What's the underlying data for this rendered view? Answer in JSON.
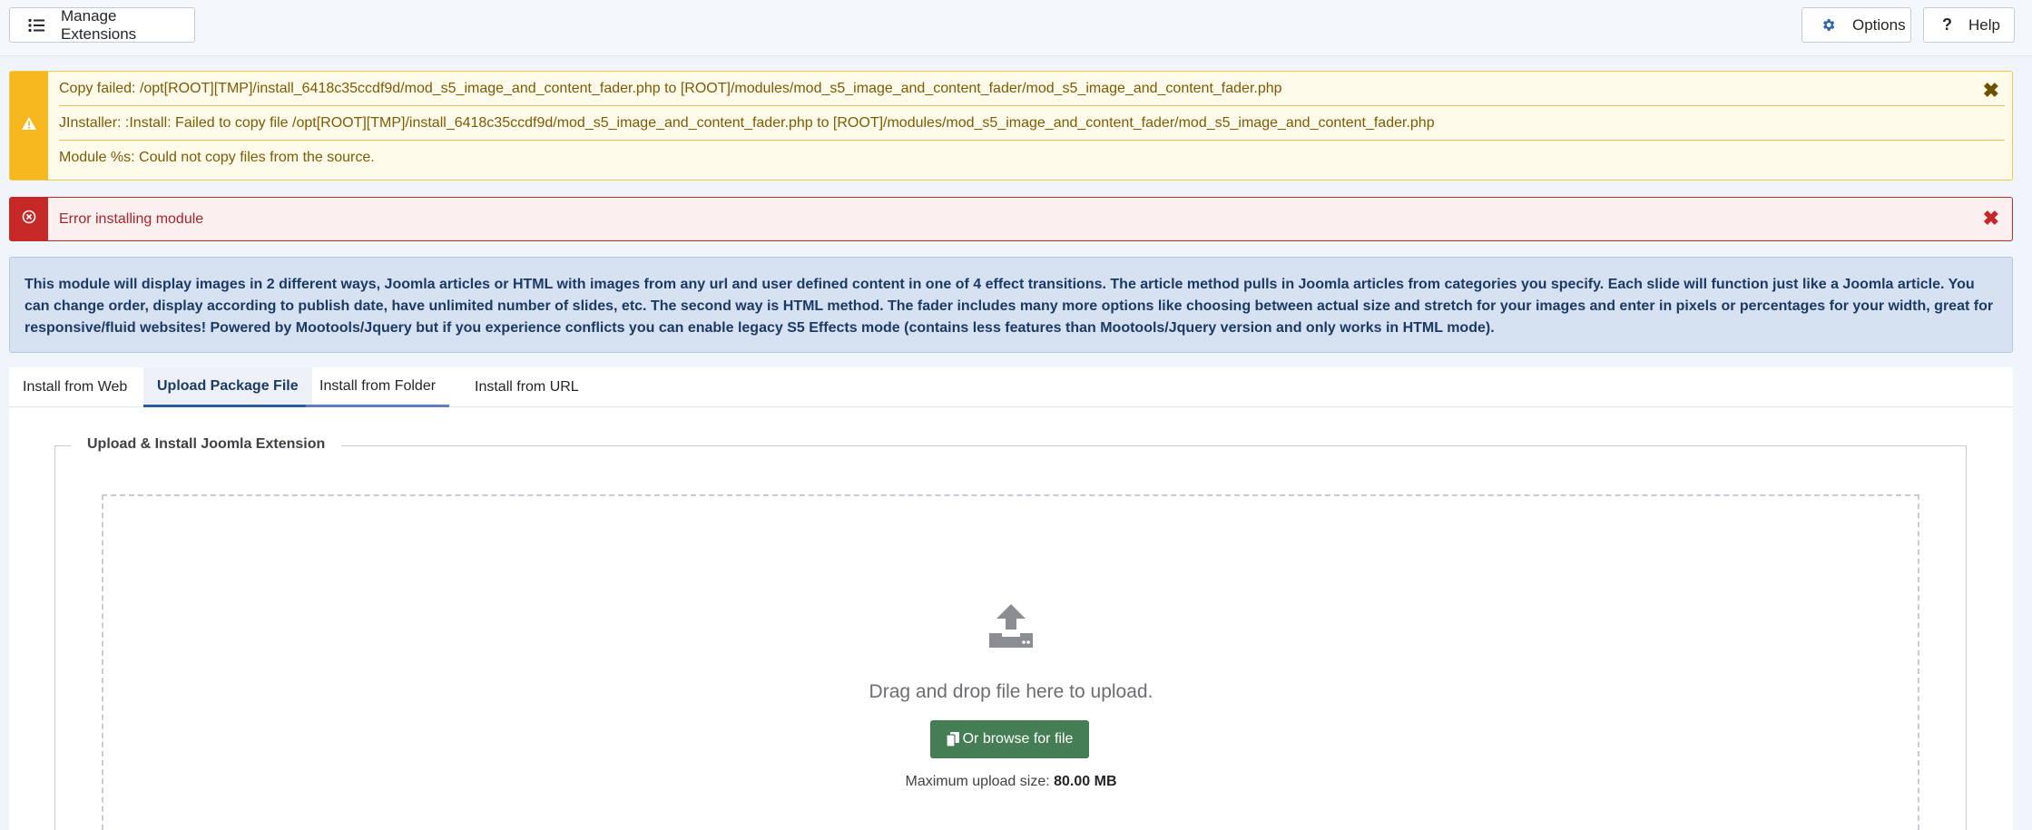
{
  "toolbar": {
    "manage_label": "Manage Extensions",
    "options_label": "Options",
    "help_label": "Help"
  },
  "alerts": {
    "warning": {
      "messages": [
        "Copy failed: /opt[ROOT][TMP]/install_6418c35ccdf9d/mod_s5_image_and_content_fader.php to [ROOT]/modules/mod_s5_image_and_content_fader/mod_s5_image_and_content_fader.php",
        "JInstaller: :Install: Failed to copy file /opt[ROOT][TMP]/install_6418c35ccdf9d/mod_s5_image_and_content_fader.php to [ROOT]/modules/mod_s5_image_and_content_fader/mod_s5_image_and_content_fader.php",
        "Module %s: Could not copy files from the source."
      ],
      "close": "✖"
    },
    "error": {
      "message": "Error installing module",
      "close": "✖"
    }
  },
  "info": {
    "text": "This module will display images in 2 different ways, Joomla articles or HTML with images from any url and user defined content in one of 4 effect transitions. The article method pulls in Joomla articles from categories you specify. Each slide will function just like a Joomla article. You can change order, display according to publish date, have unlimited number of slides, etc. The second way is HTML method. The fader includes many more options like choosing between actual size and stretch for your images and enter in pixels or percentages for your width, great for responsive/fluid websites! Powered by Mootools/Jquery but if you experience conflicts you can enable legacy S5 Effects mode (contains less features than Mootools/Jquery version and only works in HTML mode)."
  },
  "tabs": [
    {
      "label": "Install from Web"
    },
    {
      "label": "Upload Package File"
    },
    {
      "label": "Install from Folder"
    },
    {
      "label": "Install from URL"
    }
  ],
  "upload": {
    "legend": "Upload & Install Joomla Extension",
    "drag_text": "Drag and drop file here to upload.",
    "browse_label": "Or browse for file",
    "max_label": "Maximum upload size:",
    "max_value": "80.00 MB"
  },
  "colors": {
    "warning": "#f7b81f",
    "error": "#c52827",
    "info_bg": "#d6e1f2",
    "browse_button": "#457d54"
  }
}
